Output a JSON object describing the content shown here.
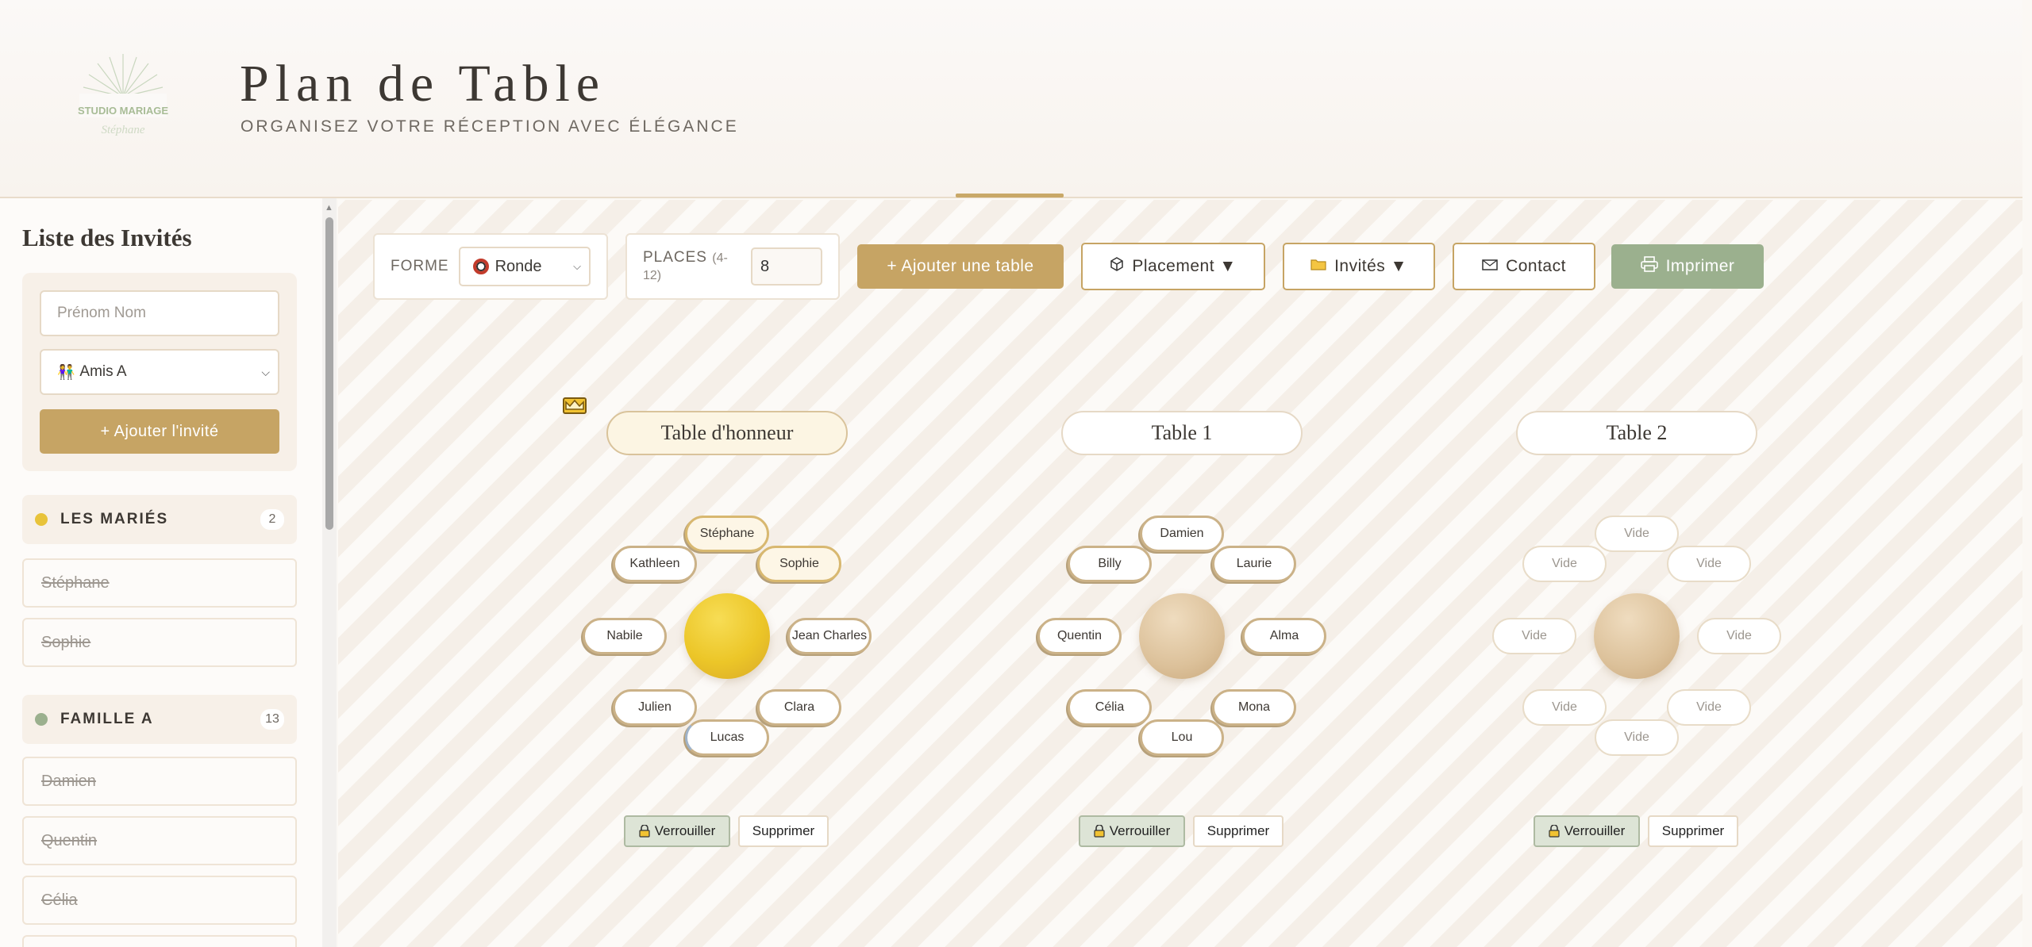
{
  "header": {
    "title": "Plan de Table",
    "subtitle": "ORGANISEZ VOTRE RÉCEPTION AVEC ÉLÉGANCE",
    "logo_line1": "STUDIO MARIAGE",
    "logo_line2": "Stéphane"
  },
  "sidebar": {
    "title": "Liste des Invités",
    "name_placeholder": "Prénom Nom",
    "group_selected": "Amis A",
    "group_icon": "👫",
    "add_button": "+ Ajouter l'invité",
    "groups": [
      {
        "name": "LES MARIÉS",
        "count": "2",
        "color": "#e8c33a",
        "guests": [
          "Stéphane",
          "Sophie"
        ]
      },
      {
        "name": "FAMILLE A",
        "count": "13",
        "color": "#9bb08e",
        "guests": [
          "Damien",
          "Quentin",
          "Célia"
        ]
      }
    ]
  },
  "toolbar": {
    "shape_label": "FORME",
    "shape_value": "Ronde",
    "places_label": "PLACES",
    "places_hint": "(4-12)",
    "places_value": "8",
    "add_table": "+ Ajouter une table",
    "placement": "Placement ▼",
    "guests": "Invités ▼",
    "contact": "Contact",
    "print": "Imprimer"
  },
  "tables": [
    {
      "name": "Table d'honneur",
      "honor": true,
      "seats": [
        "Stéphane",
        "Sophie",
        "Jean Charles",
        "Clara",
        "Lucas",
        "Julien",
        "Nabile",
        "Kathleen"
      ]
    },
    {
      "name": "Table 1",
      "honor": false,
      "seats": [
        "Damien",
        "Laurie",
        "Alma",
        "Mona",
        "Lou",
        "Célia",
        "Quentin",
        "Billy"
      ]
    },
    {
      "name": "Table 2",
      "honor": false,
      "seats": [
        "Vide",
        "Vide",
        "Vide",
        "Vide",
        "Vide",
        "Vide",
        "Vide",
        "Vide"
      ]
    }
  ],
  "table_actions": {
    "lock": "Verrouiller",
    "delete": "Supprimer"
  },
  "colors": {
    "gold": "#c6a464",
    "sage": "#9bb08e",
    "honor_disc": "#ecc628"
  }
}
